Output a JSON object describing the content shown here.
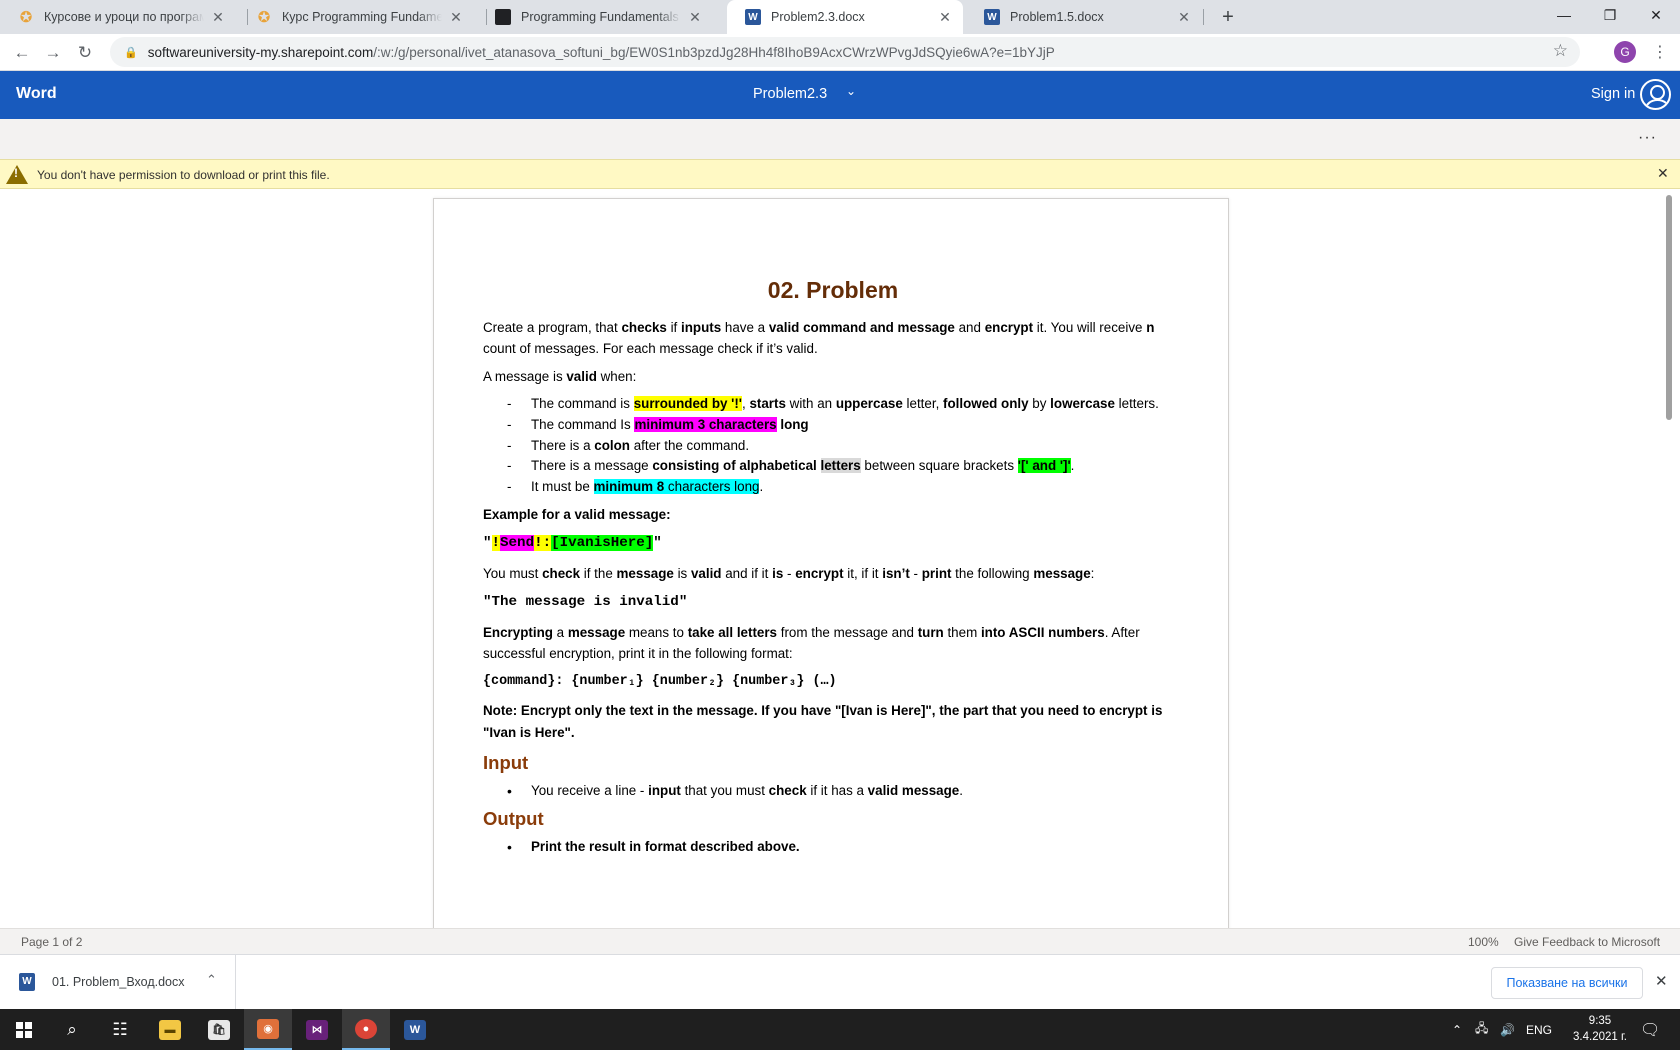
{
  "tabs": [
    {
      "title": "Курсове и уроци по програмиране",
      "icon": "softuni-icon"
    },
    {
      "title": "Курс Programming Fundamentals",
      "icon": "softuni-icon"
    },
    {
      "title": "Programming Fundamentals Final",
      "icon": "terminal-icon"
    },
    {
      "title": "Problem2.3.docx",
      "icon": "word-icon",
      "active": true
    },
    {
      "title": "Problem1.5.docx",
      "icon": "word-icon"
    }
  ],
  "address": {
    "host": "softwareuniversity-my.sharepoint.com",
    "path": "/:w:/g/personal/ivet_atanasova_softuni_bg/EW0S1nb3pzdJg28Hh4f8IhoB9AcxCWrzWPvgJdSQyie6wA?e=1bYJjP"
  },
  "profile_initial": "G",
  "word": {
    "app_name": "Word",
    "doc_name": "Problem2.3",
    "sign_in": "Sign in"
  },
  "warning": {
    "message": "You don't have permission to download or print this file."
  },
  "document": {
    "title": "02. Problem",
    "intro": {
      "t1": "Create a program, that ",
      "b1": "checks",
      "t2": " if ",
      "b2": "inputs",
      "t3": " have a ",
      "b3": "valid command and message",
      "t4": " and ",
      "b4": "encrypt",
      "t5": " it. You will receive ",
      "b5": "n",
      "t6": " count of messages. For each message check if it’s valid."
    },
    "valid_when": {
      "t1": "A message is ",
      "b1": "valid",
      "t2": " when:"
    },
    "rules": {
      "r1": {
        "t1": "The command is ",
        "h1": "surrounded by '!'",
        "t2": ", ",
        "b1": "starts",
        "t3": " with an ",
        "b2": "uppercase",
        "t4": " letter, ",
        "b3": "followed only",
        "t5": " by ",
        "b4": "lowercase",
        "t6": " letters."
      },
      "r2": {
        "t1": "The command Is ",
        "h1": "minimum 3 characters",
        "t2": " ",
        "b1": "long"
      },
      "r3": {
        "t1": "There is a ",
        "b1": "colon",
        "t2": " after the command."
      },
      "r4": {
        "t1": "There is a message ",
        "b1": "consisting of alphabetical",
        "t2": " ",
        "h1": "letters",
        "t3": " between square brackets ",
        "h2": "'[' and ']'",
        "t4": "."
      },
      "r5": {
        "t1": "It must be ",
        "h1": "minimum 8",
        "h2": " characters long",
        "t2": "."
      }
    },
    "example_label": "Example for a valid message:",
    "example": {
      "q1": "\"",
      "p1": "!",
      "p2": "Send",
      "p3": "!",
      "p4": ":",
      "p5": "[IvanisHere]",
      "q2": "\""
    },
    "check": {
      "t1": "You must ",
      "b1": "check",
      "t2": " if the ",
      "b2": "message",
      "t3": " is ",
      "b3": "valid",
      "t4": " and if it ",
      "b4": "is",
      "t5": " - ",
      "b5": "encrypt",
      "t6": " it, if it ",
      "b6": "isn’t",
      "t7": " - ",
      "b7": "print",
      "t8": " the following ",
      "b8": "message",
      "t9": ":"
    },
    "invalid_msg": "\"The message is invalid\"",
    "encrypting": {
      "b1": "Encrypting",
      "t1": " a ",
      "b2": "message",
      "t2": " means to ",
      "b3": "take all letters",
      "t3": " from the message and ",
      "b4": "turn",
      "t4": " them ",
      "b5": "into ASCII numbers",
      "t5": ". After successful encryption, print it in the following format:"
    },
    "format": "{command}: {number₁} {number₂} {number₃} (…)",
    "note": "Note: Encrypt only the text in the message. If you have \"[Ivan is Here]\", the part that you need to encrypt is \"Ivan is Here\".",
    "input_heading": "Input",
    "input_item": {
      "t1": "You receive a line - ",
      "b1": "input",
      "t2": " that you must ",
      "b2": "check",
      "t3": " if it has a ",
      "b3": "valid message",
      "t4": "."
    },
    "output_heading": "Output",
    "output_item": "Print the result in format described above."
  },
  "status": {
    "page": "Page 1 of 2",
    "zoom": "100%",
    "feedback": "Give Feedback to Microsoft"
  },
  "downloads": {
    "file": "01. Problem_Вход.docx",
    "show_all": "Показване на всички"
  },
  "taskbar": {
    "lang": "ENG",
    "time": "9:35",
    "date": "3.4.2021 г."
  }
}
